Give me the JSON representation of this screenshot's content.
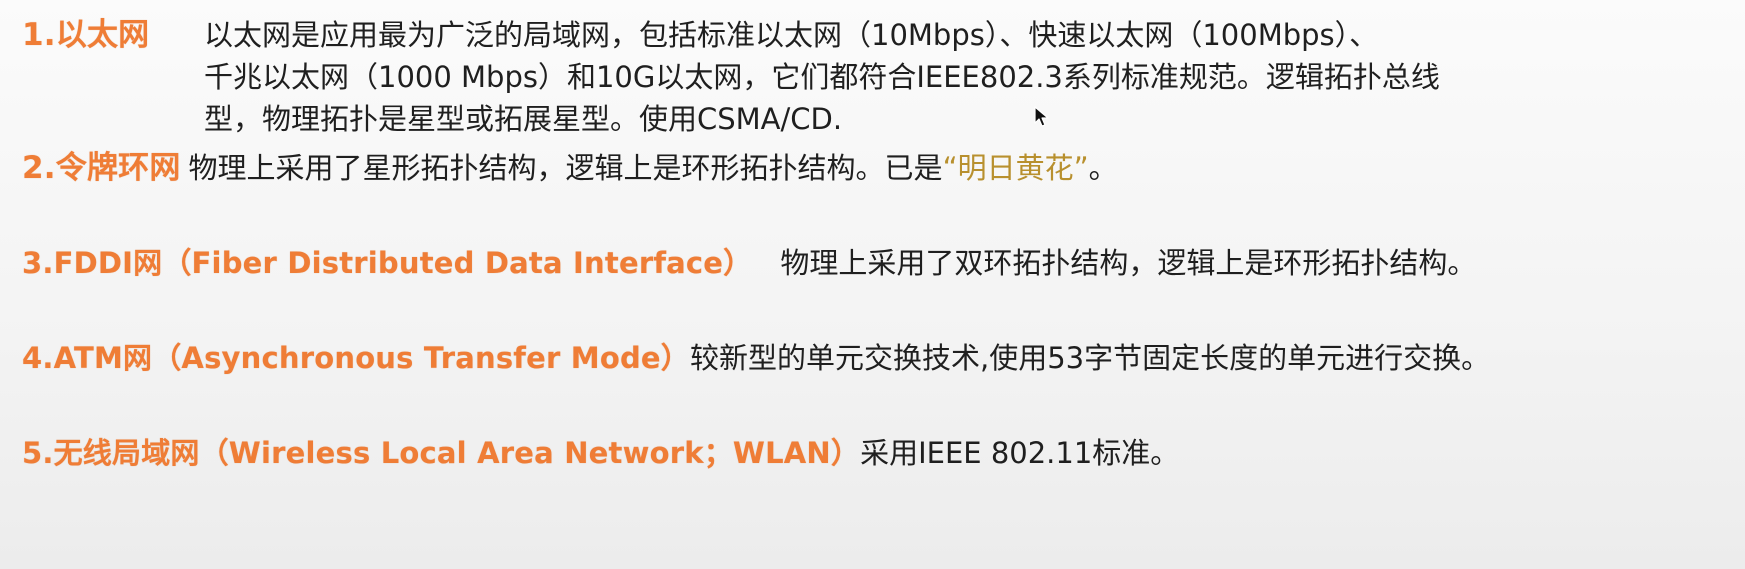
{
  "items": [
    {
      "heading": "1.以太网",
      "lines": [
        "以太网是应用最为广泛的局域网，包括标准以太网（10Mbps）、快速以太网（100Mbps）、",
        "千兆以太网（1000 Mbps）和10G以太网，它们都符合IEEE802.3系列标准规范。逻辑拓扑总线",
        "型，物理拓扑是星型或拓展星型。使用CSMA/CD."
      ]
    },
    {
      "heading": "2.令牌环网",
      "text_before_quote": "物理上采用了星形拓扑结构，逻辑上是环形拓扑结构。已是",
      "quote": "“明日黄花”",
      "text_after_quote": "。"
    },
    {
      "heading": "3.FDDI网（Fiber Distributed Data Interface）",
      "text": "物理上采用了双环拓扑结构，逻辑上是环形拓扑结构。"
    },
    {
      "heading": "4.ATM网（Asynchronous Transfer Mode）",
      "text": "较新型的单元交换技术,使用53字节固定长度的单元进行交换。"
    },
    {
      "heading": "5.无线局域网（Wireless Local Area Network；WLAN）",
      "text": "采用IEEE 802.11标准。"
    }
  ],
  "colors": {
    "heading": "#ef7d36",
    "body_text": "#1f1f1f",
    "quote": "#b8902e"
  },
  "icons": {
    "cursor": "mouse-pointer-icon"
  }
}
